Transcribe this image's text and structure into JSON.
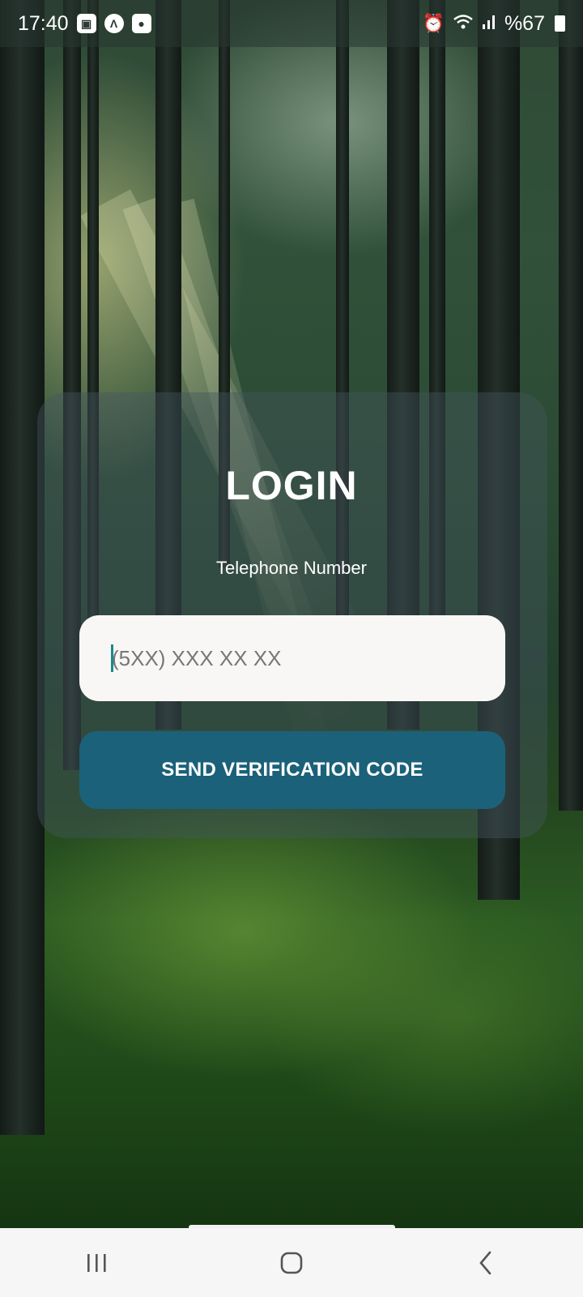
{
  "status_bar": {
    "time": "17:40",
    "left_icons": [
      "gallery-icon",
      "a-icon",
      "record-icon"
    ],
    "right_icons": [
      "alarm-icon",
      "wifi-icon",
      "signal-icon",
      "battery-icon"
    ],
    "battery": "%67"
  },
  "login": {
    "title": "LOGIN",
    "phone_label": "Telephone Number",
    "phone_placeholder": "(5XX) XXX XX XX",
    "phone_value": "",
    "send_button_label": "SEND VERIFICATION CODE"
  },
  "colors": {
    "button": "#1b6179",
    "input_bg": "#f8f7f5",
    "caret": "#1a8a8a"
  },
  "nav_bar": {
    "buttons": [
      "recents-icon",
      "home-icon",
      "back-icon"
    ]
  }
}
